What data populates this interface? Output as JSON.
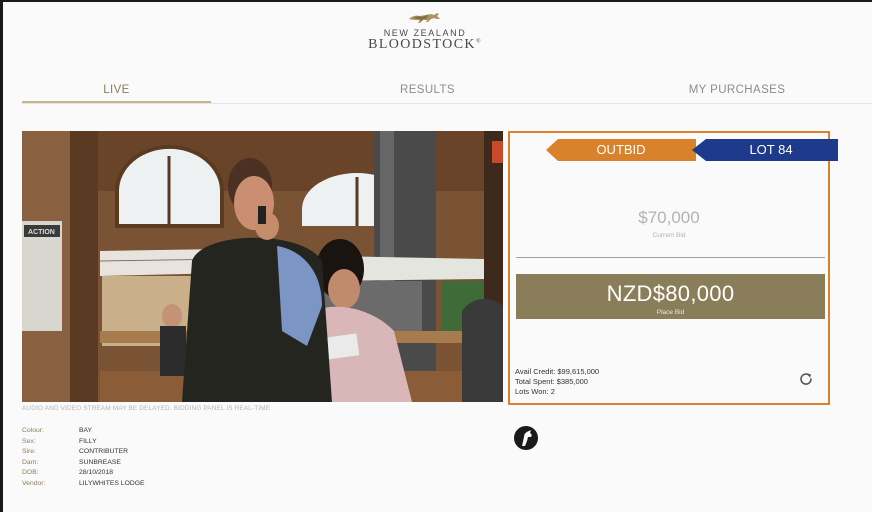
{
  "header": {
    "logo_line1": "NEW ZEALAND",
    "logo_line2": "BLOODSTOCK",
    "logo_mark": "®"
  },
  "tabs": [
    {
      "label": "LIVE",
      "active": true
    },
    {
      "label": "RESULTS",
      "active": false
    },
    {
      "label": "MY PURCHASES",
      "active": false
    }
  ],
  "video": {
    "stream_note": "AUDIO AND VIDEO STREAM MAY BE DELAYED. BIDDING PANEL IS REAL-TIME",
    "sign_text": "ACTION"
  },
  "bid_panel": {
    "status": "OUTBID",
    "lot": "LOT 84",
    "current_bid": "$70,000",
    "current_bid_label": "Current Bid",
    "place_bid_amount": "NZD$80,000",
    "place_bid_label": "Place Bid",
    "avail_credit": "Avail Credit: $99,615,000",
    "total_spent": "Total Spent: $385,000",
    "lots_won": "Lots Won: 2",
    "refresh_icon": "refresh-icon",
    "colors": {
      "outbid": "#d9822b",
      "lot": "#1e3a8a",
      "bid_button": "#8a7e5a"
    }
  },
  "horse": {
    "rows": [
      {
        "key": "Colour:",
        "value": "BAY"
      },
      {
        "key": "Sex:",
        "value": "FILLY"
      },
      {
        "key": "Sire:",
        "value": "CONTRIBUTER"
      },
      {
        "key": "Dam:",
        "value": "SUNBREASE"
      },
      {
        "key": "DOB:",
        "value": "28/10/2018"
      },
      {
        "key": "Vendor:",
        "value": "LILYWHITES LODGE"
      }
    ]
  }
}
